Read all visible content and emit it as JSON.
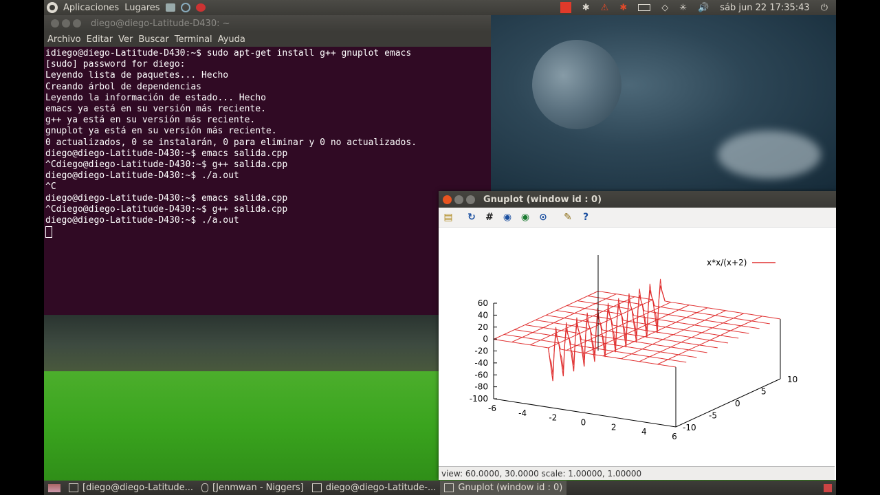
{
  "top_panel": {
    "menus": [
      "Aplicaciones",
      "Lugares"
    ],
    "clock": "sáb jun 22  17:35:43"
  },
  "terminal": {
    "title": "diego@diego-Latitude-D430: ~",
    "menu": [
      "Archivo",
      "Editar",
      "Ver",
      "Buscar",
      "Terminal",
      "Ayuda"
    ],
    "lines": [
      "idiego@diego-Latitude-D430:~$ sudo apt-get install g++ gnuplot emacs",
      "[sudo] password for diego:",
      "Leyendo lista de paquetes... Hecho",
      "Creando árbol de dependencias",
      "Leyendo la información de estado... Hecho",
      "emacs ya está en su versión más reciente.",
      "g++ ya está en su versión más reciente.",
      "gnuplot ya está en su versión más reciente.",
      "0 actualizados, 0 se instalarán, 0 para eliminar y 0 no actualizados.",
      "diego@diego-Latitude-D430:~$ emacs salida.cpp",
      "^Cdiego@diego-Latitude-D430:~$ g++ salida.cpp",
      "diego@diego-Latitude-D430:~$ ./a.out",
      "^C",
      "diego@diego-Latitude-D430:~$ emacs salida.cpp",
      "^Cdiego@diego-Latitude-D430:~$ g++ salida.cpp",
      "diego@diego-Latitude-D430:~$ ./a.out"
    ]
  },
  "gnuplot": {
    "title": "Gnuplot (window id : 0)",
    "toolbar_icons": [
      "copy-clipboard-icon",
      "replot-icon",
      "grid-icon",
      "zoom-back-icon",
      "zoom-forward-icon",
      "unzoom-icon",
      "preferences-icon",
      "help-icon"
    ],
    "status": "view: 60.0000, 30.0000  scale: 1.00000, 1.00000",
    "colors": {
      "curve": "#e03030",
      "axis": "#000000"
    }
  },
  "chart_data": {
    "type": "line",
    "title": "",
    "legend": [
      {
        "name": "x*x/(x+2)",
        "color": "#e03030"
      }
    ],
    "legend_position": "top-right",
    "surface": "3D wireframe surface",
    "x_ticks": [
      "-6",
      "-4",
      "-2",
      "0",
      "2",
      "4",
      "6"
    ],
    "y_ticks": [
      "-10",
      "-5",
      "0",
      "5",
      "10"
    ],
    "z_ticks": [
      "60",
      "40",
      "20",
      "0",
      "-20",
      "-40",
      "-60",
      "-80",
      "-100"
    ],
    "xlim": [
      -6,
      6
    ],
    "ylim": [
      -10,
      10
    ],
    "zlim": [
      -100,
      60
    ],
    "view": "60.0000, 30.0000",
    "grid": false
  },
  "taskbar": {
    "tasks": [
      {
        "label": "[diego@diego-Latitude...",
        "icon": "terminal-icon",
        "active": false
      },
      {
        "label": "[Jenmwan - Niggers]",
        "icon": "music-icon",
        "active": false
      },
      {
        "label": "diego@diego-Latitude-...",
        "icon": "terminal-icon",
        "active": false
      },
      {
        "label": "Gnuplot (window id : 0)",
        "icon": "gnuplot-icon",
        "active": true
      }
    ]
  }
}
